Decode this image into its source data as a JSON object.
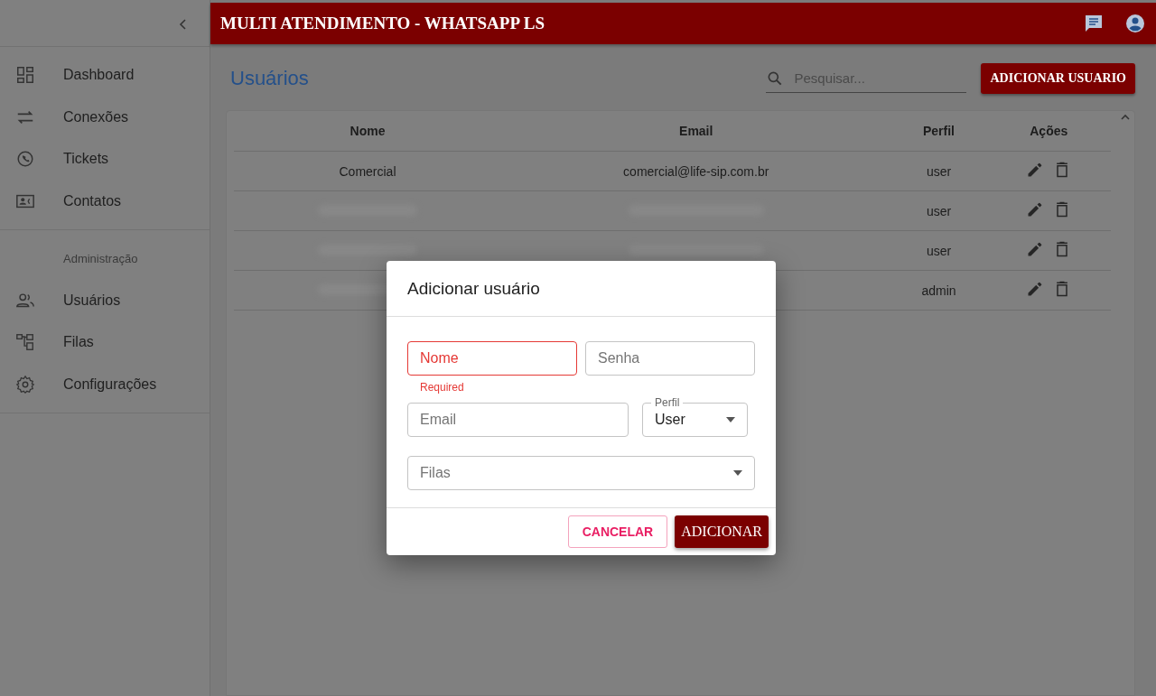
{
  "sidebar": {
    "main_items": [
      {
        "label": "Dashboard"
      },
      {
        "label": "Conexões"
      },
      {
        "label": "Tickets"
      },
      {
        "label": "Contatos"
      }
    ],
    "section_header": "Administração",
    "admin_items": [
      {
        "label": "Usuários"
      },
      {
        "label": "Filas"
      },
      {
        "label": "Configurações"
      }
    ]
  },
  "header": {
    "title": "MULTI ATENDIMENTO - WHATSAPP LS"
  },
  "page": {
    "title": "Usuários",
    "search": {
      "placeholder": "Pesquisar..."
    },
    "add_button": "ADICIONAR USUARIO"
  },
  "table": {
    "columns": [
      "Nome",
      "Email",
      "Perfil",
      "Ações"
    ],
    "rows": [
      {
        "name": "Comercial",
        "email": "comercial@life-sip.com.br",
        "profile": "user"
      },
      {
        "profile": "user"
      },
      {
        "profile": "user"
      },
      {
        "profile": "admin"
      }
    ]
  },
  "dialog": {
    "title": "Adicionar usuário",
    "name_field": {
      "placeholder": "Nome",
      "error": true,
      "helper": "Required"
    },
    "password_field": {
      "placeholder": "Senha"
    },
    "email_field": {
      "placeholder": "Email"
    },
    "profile_field": {
      "label": "Perfil",
      "value": "User"
    },
    "queues_field": {
      "placeholder": "Filas"
    },
    "cancel_button": "CANCELAR",
    "submit_button": "ADICIONAR"
  }
}
